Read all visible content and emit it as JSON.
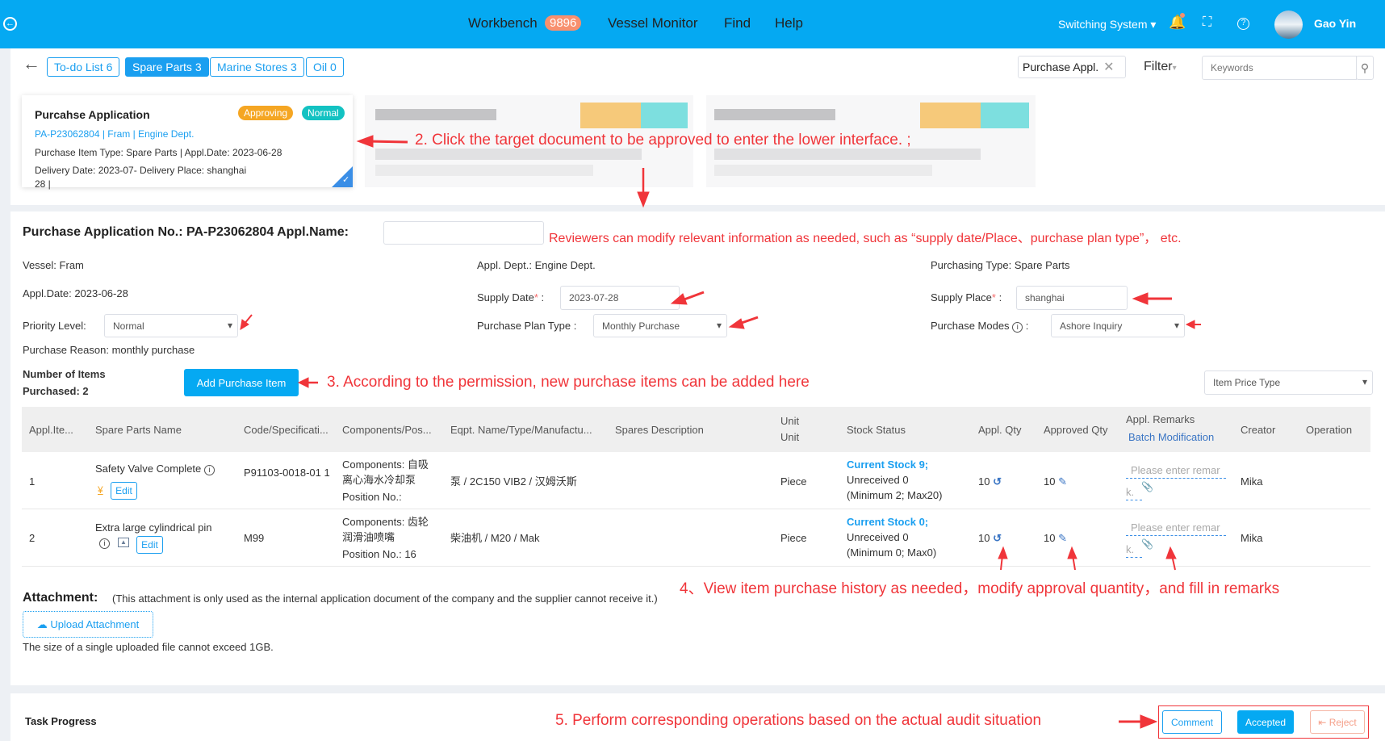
{
  "header": {
    "nav": [
      {
        "label": "Workbench",
        "badge": "9896"
      },
      {
        "label": "Vessel Monitor"
      },
      {
        "label": "Find"
      },
      {
        "label": "Help"
      }
    ],
    "switch_system": "Switching System",
    "user": "Gao Yin"
  },
  "tabs": [
    {
      "label": "To-do List 6",
      "active": false
    },
    {
      "label": "Spare Parts 3",
      "active": true
    },
    {
      "label": "Marine Stores 3",
      "active": false
    },
    {
      "label": "Oil 0",
      "active": false
    }
  ],
  "filter": {
    "tag": "Purchase Appl.",
    "filter_label": "Filter",
    "keywords_placeholder": "Keywords"
  },
  "card": {
    "title": "Purcahse Application",
    "status": "Approving",
    "priority": "Normal",
    "line1": "PA-P23062804 | Fram | Engine Dept.",
    "line2": "Purchase Item Type:  Spare Parts | Appl.Date:  2023-06-28",
    "line3": "Delivery Date:  2023-07-    Delivery Place:  shanghai",
    "line4": "28 |"
  },
  "annotations": {
    "a2": "2. Click the target document to be approved to enter the lower interface. ;",
    "a_rev": "Reviewers can modify relevant information as needed, such as  “supply date/Place、purchase plan type”， etc.",
    "a3": "3. According to the permission, new purchase items can be added here",
    "a4": "4、View item purchase history as needed，modify approval quantity，and fill in remarks",
    "a5": "5. Perform corresponding operations based on the actual audit situation"
  },
  "form": {
    "title": "Purchase Application No.:  PA-P23062804 Appl.Name:",
    "appl_name": "",
    "vessel_label": "Vessel:",
    "vessel": "Fram",
    "dept_label": "Appl. Dept.:",
    "dept": "Engine Dept.",
    "ptype_label": "Purchasing Type:",
    "ptype": "Spare Parts",
    "date_label": "Appl.Date:",
    "date": "2023-06-28",
    "supply_date_label": "Supply Date",
    "supply_date": "2023-07-28",
    "supply_place_label": "Supply Place",
    "supply_place": "shanghai",
    "priority_label": "Priority Level:",
    "priority": "Normal",
    "plan_label": "Purchase Plan Type :",
    "plan": "Monthly Purchase",
    "modes_label": "Purchase Modes",
    "modes": "Ashore Inquiry",
    "reason": "Purchase Reason: monthly purchase",
    "count_l1": "Number of Items",
    "count_l2": "Purchased:  2",
    "add_btn": "Add Purchase Item",
    "price_type": "Item Price Type"
  },
  "table": {
    "headers": [
      "Appl.Ite...",
      "Spare Parts Name",
      "Code/Specificati...",
      "Components/Pos...",
      "Eqpt. Name/Type/Manufactu...",
      "Spares Description",
      "Unit",
      "Stock Status",
      "Appl. Qty",
      "Approved Qty",
      "Appl. Remarks",
      "Creator",
      "Operation"
    ],
    "unit_sub": "Unit",
    "batch": "Batch Modification",
    "edit": "Edit",
    "remark_placeholder": "Please enter remar",
    "remark_tail": "k.",
    "rows": [
      {
        "no": "1",
        "name": "Safety Valve Complete",
        "code": "P91103-0018-01 1",
        "comp": "Components:  自吸离心海水冷却泵",
        "pos": "Position No.:",
        "eqpt": "泵 / 2C150 VIB2 / 汉姆沃斯",
        "unit": "Piece",
        "stock": "Current Stock 9;",
        "stock_rest": " Unreceived 0",
        "minmax": "(Minimum 2; Max20)",
        "qty": "10",
        "appr": "10",
        "creator": "Mika"
      },
      {
        "no": "2",
        "name": "Extra large cylindrical pin",
        "code": "M99",
        "comp": "Components:  齿轮润滑油喷嘴",
        "pos": "Position No.:  16",
        "eqpt": "柴油机 / M20 / Mak",
        "unit": "Piece",
        "stock": "Current Stock 0;",
        "stock_rest": " Unreceived 0",
        "minmax": "(Minimum 0; Max0)",
        "qty": "10",
        "appr": "10",
        "creator": "Mika"
      }
    ]
  },
  "attachment": {
    "title": "Attachment:",
    "note": "(This attachment is only used as the internal application document of the company and the supplier cannot receive it.)",
    "upload": "Upload Attachment",
    "limit": "The size of a single uploaded file cannot exceed 1GB."
  },
  "task": {
    "title": "Task Progress",
    "comment": "Comment",
    "accepted": "Accepted",
    "reject": "Reject"
  },
  "colors": {
    "header": "#05a9f2",
    "accent": "#1a9ff0",
    "annotation": "#f0353a",
    "approving": "#f5a623",
    "normal": "#13c2c2"
  }
}
